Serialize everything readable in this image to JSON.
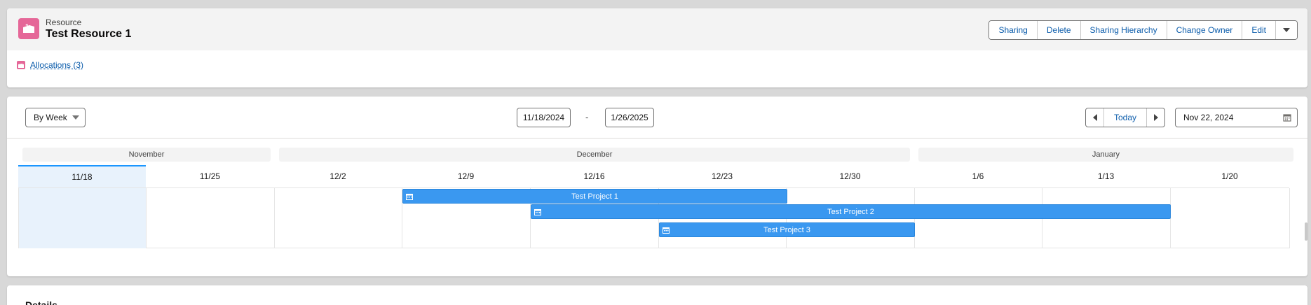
{
  "record": {
    "object_type": "Resource",
    "name": "Test Resource 1",
    "icon": "briefcase-icon",
    "icon_color": "#e56798"
  },
  "actions": [
    {
      "label": "Sharing"
    },
    {
      "label": "Delete"
    },
    {
      "label": "Sharing Hierarchy"
    },
    {
      "label": "Change Owner"
    },
    {
      "label": "Edit"
    }
  ],
  "related": {
    "allocations_label": "Allocations (3)"
  },
  "timeline": {
    "view_mode": "By Week",
    "range_start": "11/18/2024",
    "range_separator": "-",
    "range_end": "1/26/2025",
    "today_label": "Today",
    "selected_date": "Nov 22, 2024",
    "months": [
      "November",
      "December",
      "January"
    ],
    "weeks": [
      "11/18",
      "11/25",
      "12/2",
      "12/9",
      "12/16",
      "12/23",
      "12/30",
      "1/6",
      "1/13",
      "1/20"
    ],
    "current_week": "11/18",
    "bar_color": "#3a98f0",
    "bars": [
      {
        "label": "Test Project 1",
        "icon": "calendar-icon"
      },
      {
        "label": "Test Project 2",
        "icon": "calendar-icon"
      },
      {
        "label": "Test Project 3",
        "icon": "calendar-icon"
      }
    ]
  },
  "details": {
    "title": "Details"
  }
}
